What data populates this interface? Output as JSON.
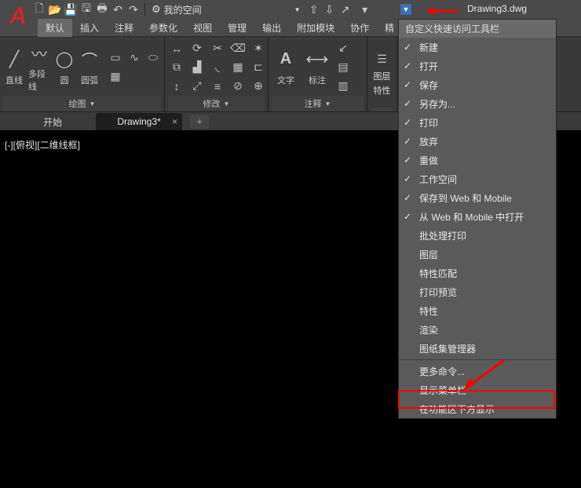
{
  "title": "Drawing3.dwg",
  "workspace": "我的空间",
  "menu": [
    "默认",
    "插入",
    "注释",
    "参数化",
    "视图",
    "管理",
    "输出",
    "附加模块",
    "协作",
    "精"
  ],
  "active_menu": 0,
  "panels": {
    "draw": {
      "label": "绘图",
      "buttons": [
        "直线",
        "多段线",
        "圆",
        "圆弧"
      ]
    },
    "modify": {
      "label": "修改"
    },
    "annot": {
      "label": "注释",
      "buttons": [
        "文字",
        "标注"
      ]
    },
    "layer": {
      "label1": "图层",
      "label2": "特性"
    }
  },
  "tabs": [
    {
      "label": "开始",
      "active": false
    },
    {
      "label": "Drawing3*",
      "active": true
    }
  ],
  "viewlabel": "[-][俯视][二维线框]",
  "qat_menu": {
    "title": "自定义快速访问工具栏",
    "items": [
      {
        "label": "新建",
        "checked": true
      },
      {
        "label": "打开",
        "checked": true
      },
      {
        "label": "保存",
        "checked": true
      },
      {
        "label": "另存为...",
        "checked": true
      },
      {
        "label": "打印",
        "checked": true
      },
      {
        "label": "放弃",
        "checked": true
      },
      {
        "label": "重做",
        "checked": true
      },
      {
        "label": "工作空间",
        "checked": true
      },
      {
        "label": "保存到 Web 和 Mobile",
        "checked": true
      },
      {
        "label": "从 Web 和 Mobile 中打开",
        "checked": true
      },
      {
        "label": "批处理打印",
        "checked": false
      },
      {
        "label": "图层",
        "checked": false
      },
      {
        "label": "特性匹配",
        "checked": false
      },
      {
        "label": "打印预览",
        "checked": false
      },
      {
        "label": "特性",
        "checked": false
      },
      {
        "label": "渲染",
        "checked": false
      },
      {
        "label": "图纸集管理器",
        "checked": false
      }
    ],
    "after_sep": [
      {
        "label": "更多命令..."
      },
      {
        "label": "显示菜单栏"
      },
      {
        "label": "在功能区下方显示"
      }
    ]
  }
}
